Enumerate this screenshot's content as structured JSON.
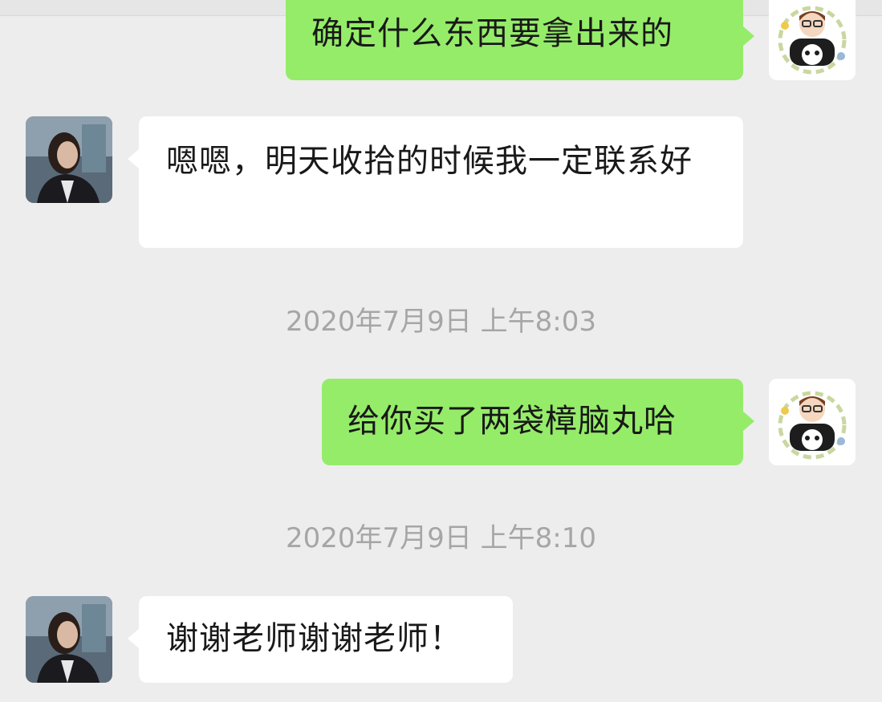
{
  "messages": [
    {
      "type": "sent",
      "sender": "me",
      "text": "确定什么东西要拿出来的"
    },
    {
      "type": "received",
      "sender": "contact",
      "text": "嗯嗯，明天收拾的时候我一定联系好"
    },
    {
      "type": "timestamp",
      "text": "2020年7月9日 上午8:03"
    },
    {
      "type": "sent",
      "sender": "me",
      "text": "给你买了两袋樟脑丸哈"
    },
    {
      "type": "timestamp",
      "text": "2020年7月9日 上午8:10"
    },
    {
      "type": "received",
      "sender": "contact",
      "text": "谢谢老师谢谢老师！"
    }
  ],
  "colors": {
    "background": "#ededed",
    "sent_bubble": "#95ec69",
    "received_bubble": "#ffffff",
    "timestamp_text": "#a6a6a6"
  },
  "icons": {
    "my_avatar": "cartoon-boy-panda-avatar",
    "contact_avatar": "portrait-photo-avatar"
  }
}
